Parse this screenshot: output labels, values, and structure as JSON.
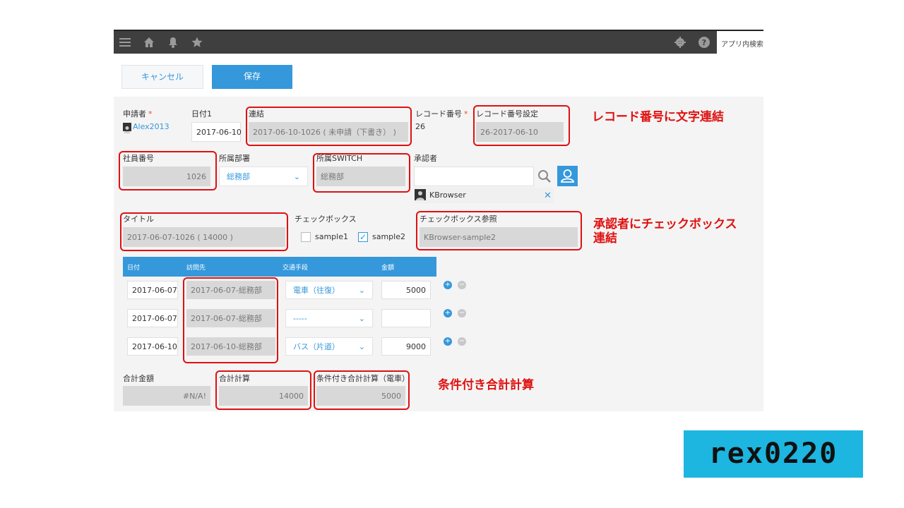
{
  "topbar": {
    "icons": [
      "menu-icon",
      "home-icon",
      "bell-icon",
      "star-icon",
      "gear-icon",
      "help-icon"
    ],
    "search_placeholder": "アプリ内検索"
  },
  "actions": {
    "cancel_label": "キャンセル",
    "save_label": "保存"
  },
  "form": {
    "applicant": {
      "label": "申請者",
      "required_mark": "*",
      "value": "Alex2013"
    },
    "date1": {
      "label": "日付1",
      "value": "2017-06-10"
    },
    "concat": {
      "label": "連結",
      "value": "2017-06-10-1026 ( 未申請（下書き） )"
    },
    "record_no": {
      "label": "レコード番号",
      "required_mark": "*",
      "value": "26"
    },
    "record_no_setting": {
      "label": "レコード番号設定",
      "value": "26-2017-06-10"
    },
    "employee_no": {
      "label": "社員番号",
      "value": "1026"
    },
    "department": {
      "label": "所属部署",
      "value": "総務部"
    },
    "dept_switch": {
      "label": "所属SWITCH",
      "value": "総務部"
    },
    "approver": {
      "label": "承認者",
      "selected_user": "KBrowser"
    },
    "title": {
      "label": "タイトル",
      "value": "2017-06-07-1026 ( 14000 )"
    },
    "checkbox": {
      "label": "チェックボックス",
      "options": [
        {
          "label": "sample1",
          "checked": false
        },
        {
          "label": "sample2",
          "checked": true
        }
      ]
    },
    "checkbox_ref": {
      "label": "チェックボックス参照",
      "value": "KBrowser-sample2"
    },
    "table": {
      "headers": [
        "日付",
        "訪問先",
        "交通手段",
        "金額"
      ],
      "rows": [
        {
          "date": "2017-06-07",
          "destination": "2017-06-07-総務部",
          "transport": "電車（往復）",
          "amount": "5000"
        },
        {
          "date": "2017-06-07",
          "destination": "2017-06-07-総務部",
          "transport": "-----",
          "amount": ""
        },
        {
          "date": "2017-06-10",
          "destination": "2017-06-10-総務部",
          "transport": "バス（片道）",
          "amount": "9000"
        }
      ]
    },
    "total_amount": {
      "label": "合計金額",
      "value": "#N/A!"
    },
    "total_calc": {
      "label": "合計計算",
      "value": "14000"
    },
    "conditional_total": {
      "label": "条件付き合計計算（電車）",
      "value": "5000"
    }
  },
  "annotations": {
    "record_concat": "レコード番号に文字連結",
    "approver_checkbox_line1": "承認者にチェックボックス",
    "approver_checkbox_line2": "連結",
    "conditional_sum": "条件付き合計計算"
  },
  "logo_text": "rex0220",
  "colors": {
    "accent": "#3498db",
    "annotation_red": "#e01010",
    "logo_bg": "#1db6e0",
    "topbar": "#3f3f3f"
  }
}
